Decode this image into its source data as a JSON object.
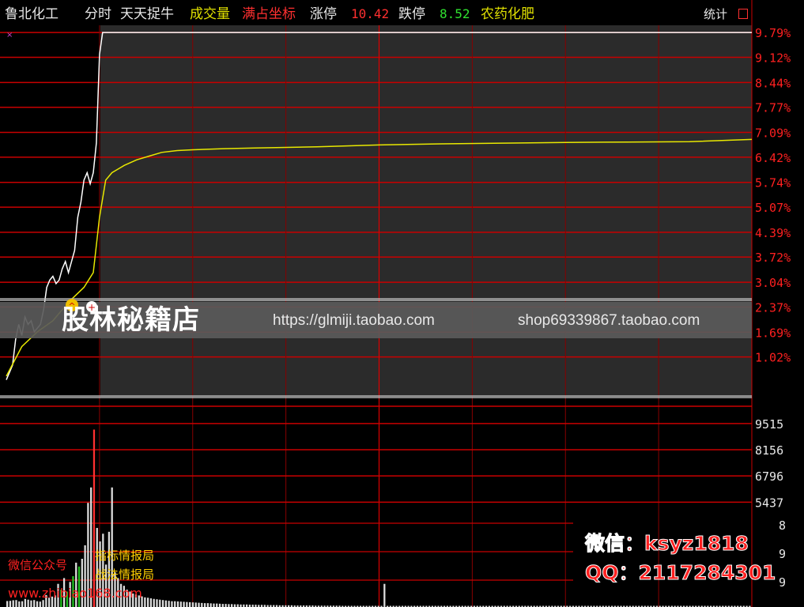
{
  "header": {
    "stock_name": "鲁北化工",
    "view_mode": "分时",
    "indicator_name": "天天捉牛",
    "volume_label": "成交量",
    "coord_label": "满占坐标",
    "limit_up_label": "涨停",
    "limit_up_value": "10.42",
    "limit_down_label": "跌停",
    "limit_down_value": "8.52",
    "sector": "农药化肥",
    "stats_button": "统计"
  },
  "watermark": {
    "brand": "股林秘籍店",
    "url1": "https://glmiji.taobao.com",
    "url2": "shop69339867.taobao.com"
  },
  "promo": {
    "wechat": "微信：ksyz1818",
    "qq": "QQ：2117284301",
    "public_account": "微信公众号",
    "label1": "指标情报局",
    "label2": "战法情报局",
    "site": "www.zhibiao168.com"
  },
  "chart_data": [
    {
      "type": "line",
      "y_ticks": [
        "9.79%",
        "9.12%",
        "8.44%",
        "7.77%",
        "7.09%",
        "6.42%",
        "5.74%",
        "5.07%",
        "4.39%",
        "3.72%",
        "3.04%",
        "2.37%",
        "1.69%",
        "1.02%"
      ],
      "ylim": [
        0.2,
        9.9
      ],
      "xlim": [
        0,
        240
      ],
      "series": [
        {
          "color": "#ffffff",
          "x": [
            0,
            2,
            3,
            4,
            5,
            6,
            7,
            8,
            9,
            10,
            11,
            12,
            13,
            14,
            15,
            16,
            17,
            18,
            19,
            20,
            22,
            23,
            24,
            25,
            26,
            27,
            28,
            29,
            30,
            31,
            240
          ],
          "y": [
            0.4,
            0.8,
            1.5,
            1.9,
            1.6,
            2.1,
            1.9,
            2.0,
            1.7,
            1.8,
            1.9,
            2.3,
            2.9,
            3.1,
            3.2,
            3.0,
            3.1,
            3.4,
            3.6,
            3.3,
            3.9,
            4.8,
            5.2,
            5.8,
            6.0,
            5.7,
            6.0,
            6.8,
            9.2,
            9.79,
            9.79
          ]
        },
        {
          "color": "#e8e800",
          "x": [
            0,
            5,
            10,
            15,
            20,
            25,
            28,
            30,
            32,
            34,
            36,
            38,
            42,
            46,
            50,
            55,
            60,
            70,
            80,
            100,
            120,
            140,
            160,
            180,
            200,
            220,
            240
          ],
          "y": [
            0.5,
            1.3,
            1.7,
            2.0,
            2.5,
            2.9,
            3.3,
            4.8,
            5.8,
            6.0,
            6.1,
            6.2,
            6.35,
            6.45,
            6.55,
            6.6,
            6.62,
            6.65,
            6.67,
            6.7,
            6.75,
            6.78,
            6.8,
            6.82,
            6.83,
            6.84,
            6.9
          ]
        }
      ]
    },
    {
      "type": "bar",
      "y_ticks": [
        "9515",
        "8156",
        "6796",
        "5437"
      ],
      "right_labels": [
        "8",
        "9",
        "9"
      ],
      "ylim": [
        0,
        10000
      ],
      "values": [
        310,
        320,
        350,
        360,
        290,
        300,
        420,
        380,
        340,
        360,
        300,
        280,
        360,
        620,
        480,
        540,
        600,
        1200,
        900,
        1500,
        800,
        1300,
        1600,
        2300,
        2100,
        2500,
        3200,
        5400,
        6200,
        9200,
        4100,
        3400,
        3800,
        2200,
        3900,
        6200,
        1800,
        1500,
        1200,
        1100,
        900,
        800,
        700,
        650,
        600,
        550,
        500,
        480,
        450,
        420,
        400,
        380,
        360,
        340,
        320,
        300,
        300,
        290,
        280,
        270,
        260,
        250,
        240,
        230,
        220,
        210,
        200,
        200,
        190,
        180,
        180,
        170,
        160,
        160,
        150,
        150,
        140,
        140,
        130,
        130,
        130,
        120,
        120,
        120,
        110,
        110,
        110,
        100,
        100,
        100,
        100,
        90,
        90,
        90,
        90,
        90,
        80,
        80,
        80,
        80,
        80,
        80,
        80,
        70,
        70,
        70,
        70,
        70,
        70,
        70,
        70,
        70,
        60,
        60,
        60,
        60,
        60,
        60,
        60,
        60,
        60,
        60,
        60,
        60,
        60,
        60,
        1200,
        60,
        60,
        60,
        60,
        60,
        60,
        60,
        60,
        60,
        60,
        60,
        60,
        60,
        60,
        60,
        60,
        60,
        60,
        60,
        60,
        60,
        60,
        60,
        60,
        60,
        60,
        60,
        60,
        60,
        60,
        60,
        60,
        60,
        60,
        60,
        60,
        60,
        60,
        60,
        60,
        60,
        60,
        60,
        60,
        60,
        60,
        60,
        60,
        60,
        60,
        60,
        60,
        60,
        60,
        60,
        60,
        60,
        60,
        60,
        60,
        60,
        60,
        60,
        60,
        60,
        60,
        60,
        60,
        60,
        60,
        60,
        60,
        60,
        60,
        60,
        60,
        60,
        60,
        60,
        60,
        60,
        60,
        60,
        60,
        60,
        60,
        60,
        60,
        60,
        60,
        60,
        60,
        60,
        60,
        60,
        60,
        60,
        60,
        60,
        60,
        60,
        60,
        60,
        60,
        60,
        60,
        60,
        60,
        60,
        60,
        60,
        60,
        60,
        60,
        60,
        60,
        60,
        60,
        60,
        60,
        60,
        60
      ]
    }
  ]
}
